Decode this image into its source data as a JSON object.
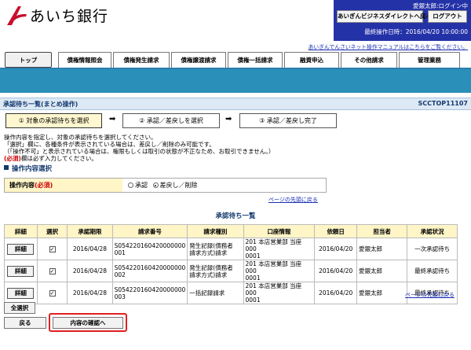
{
  "bank": {
    "name": "あいち銀行"
  },
  "header": {
    "user_line": "愛銀太郎:ログイン中",
    "direct_button": "あいぎんビジネスダイレクトへ戻る",
    "logout_button": "ログアウト",
    "last_op_label": "最終操作日時：",
    "last_op_value": "2016/04/20 10:00:00",
    "manual_link": "あいぎんでんさいネット操作マニュアルはこちらをご覧ください。"
  },
  "tabs": [
    "トップ",
    "債権情報照会",
    "債権発生請求",
    "債権譲渡請求",
    "債権一括請求",
    "融資申込",
    "その他請求",
    "管理業務"
  ],
  "page": {
    "title": "承認待ち一覧(まとめ操作)",
    "screen_id": "SCCTOP11107"
  },
  "steps": [
    "① 対象の承認待ちを選択",
    "② 承認／差戻しを選択",
    "③ 承認／差戻し完了"
  ],
  "instructions": {
    "line1": "操作内容を指定し、対象の承認待ちを選択してください。",
    "line2": "「選択」欄に、各種条件が表示されている場合は、差戻し／削除のみ可能です。",
    "line3": "（「操作不可」と表示されている場合は、権限もしくは取引の状態が不正なため、お取引できません。）",
    "required_mark": "(必須)",
    "line4_suffix": "欄は必ず入力してください。"
  },
  "op_section": {
    "heading": "操作内容選択",
    "label": "操作内容",
    "required": "(必須)",
    "option_approve": "承認",
    "option_reject": "差戻し／削除",
    "selected": "差戻し／削除"
  },
  "page_top_link": "ページの先頭に戻る",
  "list": {
    "title": "承認待ち一覧",
    "columns": [
      "詳細",
      "選択",
      "承認期限",
      "請求番号",
      "請求種別",
      "口座情報",
      "依頼日",
      "担当者",
      "承認状況"
    ],
    "detail_label": "詳細",
    "rows": [
      {
        "deadline": "2016/04/28",
        "req_no_1": "S054220160420000000",
        "req_no_2": "001",
        "type_1": "発生記録(債務者",
        "type_2": "請求方式)請求",
        "acct_1": "201 本店営業部 当座 000",
        "acct_2": "0001",
        "date": "2016/04/20",
        "person": "愛銀太郎",
        "status": "一次承認待ち"
      },
      {
        "deadline": "2016/04/28",
        "req_no_1": "S054220160420000000",
        "req_no_2": "002",
        "type_1": "発生記録(債務者",
        "type_2": "請求方式)請求",
        "acct_1": "201 本店営業部 当座 000",
        "acct_2": "0001",
        "date": "2016/04/20",
        "person": "愛銀太郎",
        "status": "最終承認待ち"
      },
      {
        "deadline": "2016/04/28",
        "req_no_1": "S054220160420000000",
        "req_no_2": "003",
        "type_1": "一括記録請求",
        "type_2": "",
        "acct_1": "201 本店営業部 当座 000",
        "acct_2": "0001",
        "date": "2016/04/20",
        "person": "愛銀太郎",
        "status": "最終承認待ち"
      }
    ]
  },
  "buttons": {
    "select_all": "全選択",
    "back": "戻る",
    "confirm": "内容の確認へ"
  },
  "colors": {
    "accent": "#2432a8",
    "band": "#2a8fb9",
    "highlight": "#e02020",
    "label_bg": "#fff5c7"
  }
}
